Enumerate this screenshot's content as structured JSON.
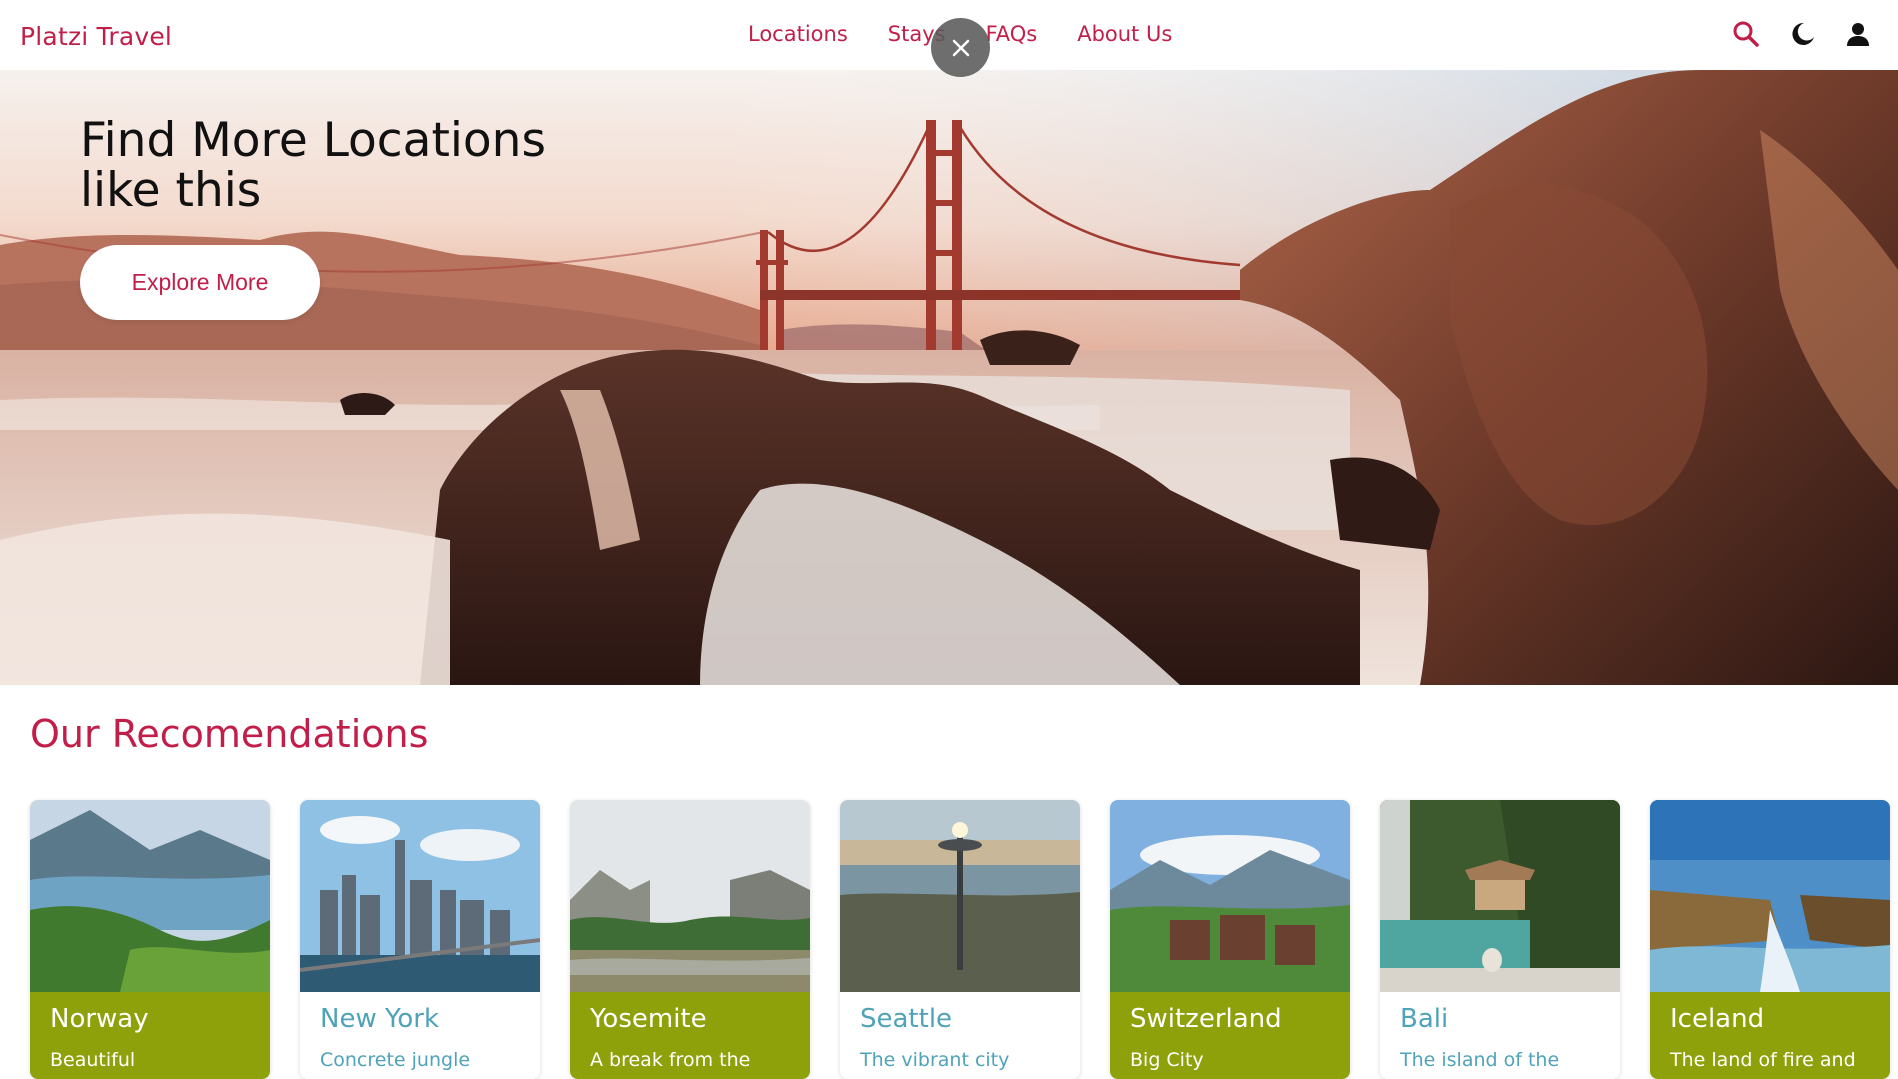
{
  "header": {
    "logo": "Platzi Travel",
    "nav": [
      "Locations",
      "Stays",
      "FAQs",
      "About Us"
    ]
  },
  "icons": [
    "search-icon",
    "dark-mode-moon-icon",
    "user-icon",
    "close-icon"
  ],
  "hero": {
    "title": "Find More Locations like this",
    "button": "Explore More"
  },
  "recommendations": {
    "title": "Our Recomendations",
    "cards": [
      {
        "name": "Norway",
        "desc": "Beautiful",
        "style": "green"
      },
      {
        "name": "New York",
        "desc": "Concrete jungle",
        "style": "white"
      },
      {
        "name": "Yosemite",
        "desc": "A break from the",
        "style": "green"
      },
      {
        "name": "Seattle",
        "desc": "The vibrant city",
        "style": "white"
      },
      {
        "name": "Switzerland",
        "desc": "Big City",
        "style": "green"
      },
      {
        "name": "Bali",
        "desc": "The island of the",
        "style": "white"
      },
      {
        "name": "Iceland",
        "desc": "The land of fire and",
        "style": "green"
      }
    ]
  },
  "colors": {
    "brand": "#c21e4a",
    "card_green": "#8ea10a",
    "card_text_alt": "#4fa3b8"
  }
}
